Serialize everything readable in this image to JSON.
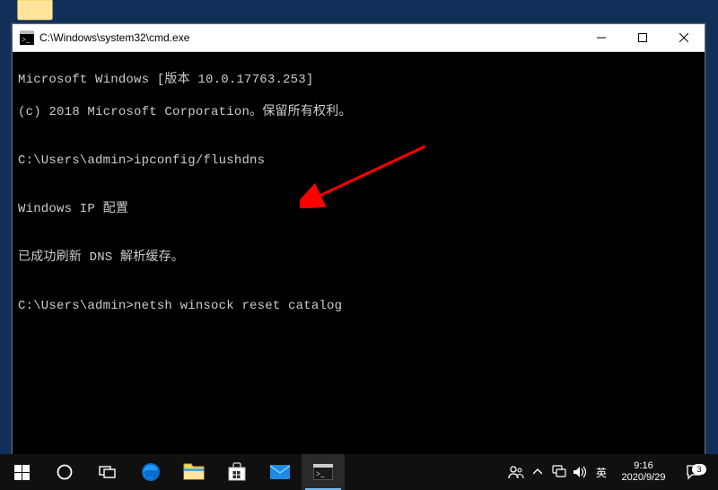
{
  "desktop_icons": {
    "folder1_name": "folder-icon",
    "folder2_name": "folder-icon"
  },
  "window": {
    "title": "C:\\Windows\\system32\\cmd.exe"
  },
  "terminal": {
    "lines": [
      "Microsoft Windows [版本 10.0.17763.253]",
      "(c) 2018 Microsoft Corporation。保留所有权利。",
      "",
      "C:\\Users\\admin>ipconfig/flushdns",
      "",
      "Windows IP 配置",
      "",
      "已成功刷新 DNS 解析缓存。",
      "",
      "C:\\Users\\admin>netsh winsock reset catalog"
    ],
    "prompt1": "C:\\Users\\admin>",
    "command1": "ipconfig/flushdns",
    "prompt2": "C:\\Users\\admin>",
    "command2": "netsh winsock reset catalog"
  },
  "annotation": {
    "arrow_color": "#ff0000"
  },
  "taskbar": {
    "ime": "英",
    "time": "9:16",
    "date": "2020/9/29",
    "notification_count": "3"
  }
}
